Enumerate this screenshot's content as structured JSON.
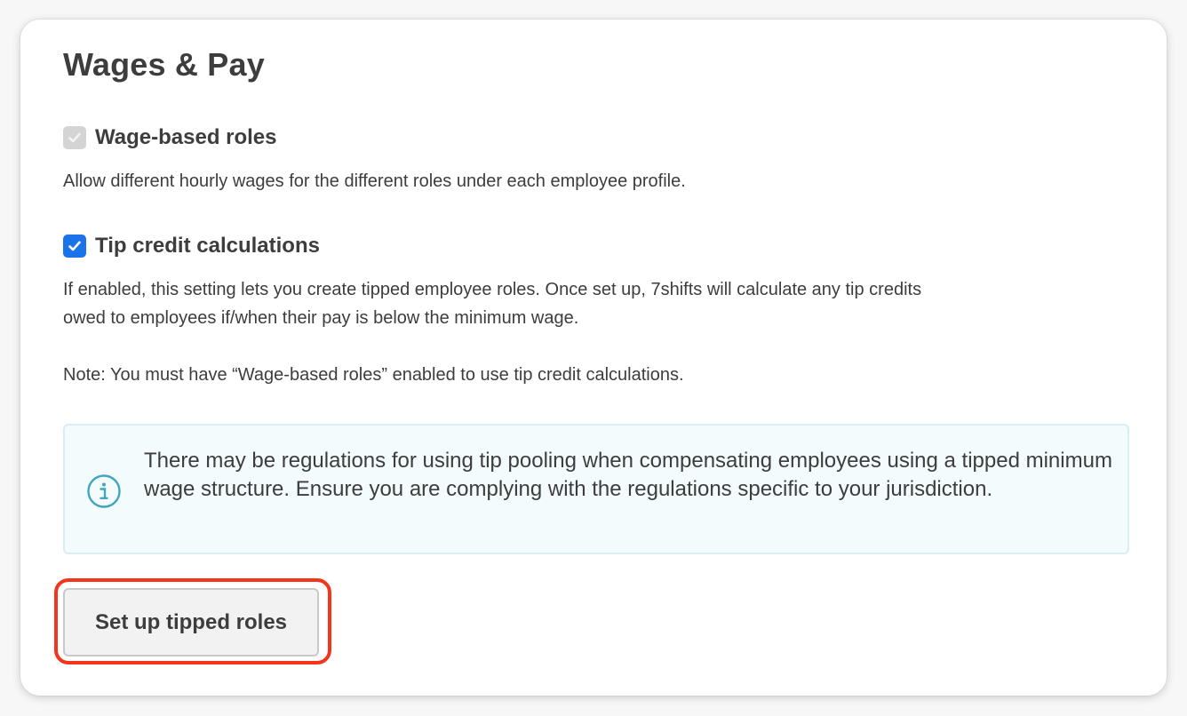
{
  "section": {
    "title": "Wages & Pay"
  },
  "wage_roles": {
    "label": "Wage-based roles",
    "checked": true,
    "disabled": true,
    "description": "Allow different hourly wages for the different roles under each employee profile."
  },
  "tip_credit": {
    "label": "Tip credit calculations",
    "checked": true,
    "description_line1": "If enabled, this setting lets you create tipped employee roles. Once set up, 7shifts will calculate any tip credits",
    "description_line2": "owed to employees if/when their pay is below the minimum wage.",
    "note": "Note: You must have “Wage-based roles” enabled to use tip credit calculations."
  },
  "info_banner": {
    "icon": "info-icon",
    "text": "There may be regulations for using tip pooling when compensating employees using a tipped minimum wage structure. Ensure you are complying with the regulations specific to your jurisdiction."
  },
  "actions": {
    "setup_button_label": "Set up tipped roles"
  },
  "colors": {
    "checkbox_checked": "#1a73e8",
    "checkbox_disabled": "#d4d4d4",
    "info_background": "#f3fbfd",
    "info_icon": "#3fa6bd",
    "highlight": "#f2351c"
  }
}
